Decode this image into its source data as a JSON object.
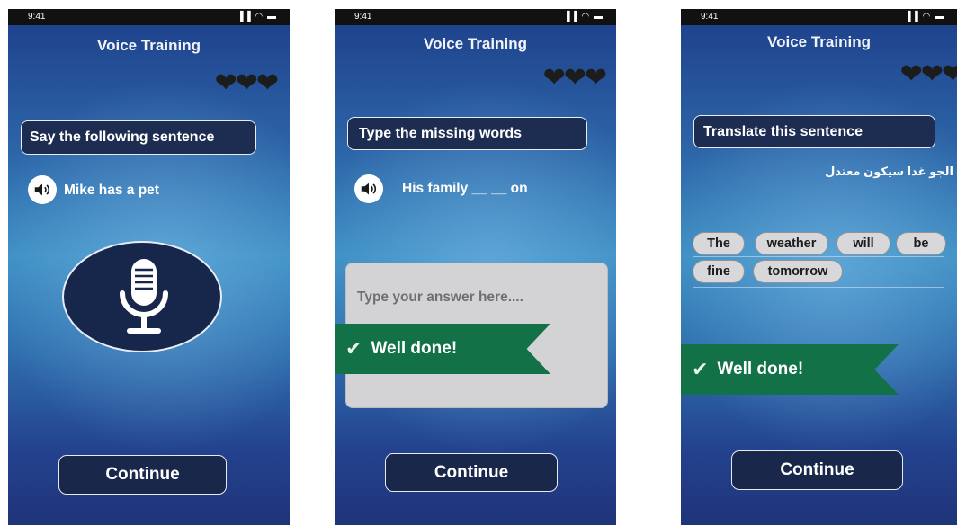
{
  "common": {
    "status_time": "9:41",
    "status_icons": "▐▐ ◠ ▬",
    "title": "Voice Training",
    "hearts": "❤❤❤",
    "continue_label": "Continue",
    "well_done": "Well done!"
  },
  "screen1": {
    "prompt": "Say the following sentence",
    "sentence": "Mike has a pet"
  },
  "screen2": {
    "prompt": "Type the missing words",
    "sentence": "His family __ __ on",
    "answer_placeholder": "Type your answer here...."
  },
  "screen3": {
    "prompt": "Translate this sentence",
    "arabic_sentence": "الجو غدا سيكون معتدل",
    "words": [
      "The",
      "weather",
      "will",
      "be",
      "fine",
      "tomorrow"
    ]
  },
  "colors": {
    "button_navy": "#19284a",
    "banner_green": "#127147",
    "word_chip": "#d8d8da"
  }
}
